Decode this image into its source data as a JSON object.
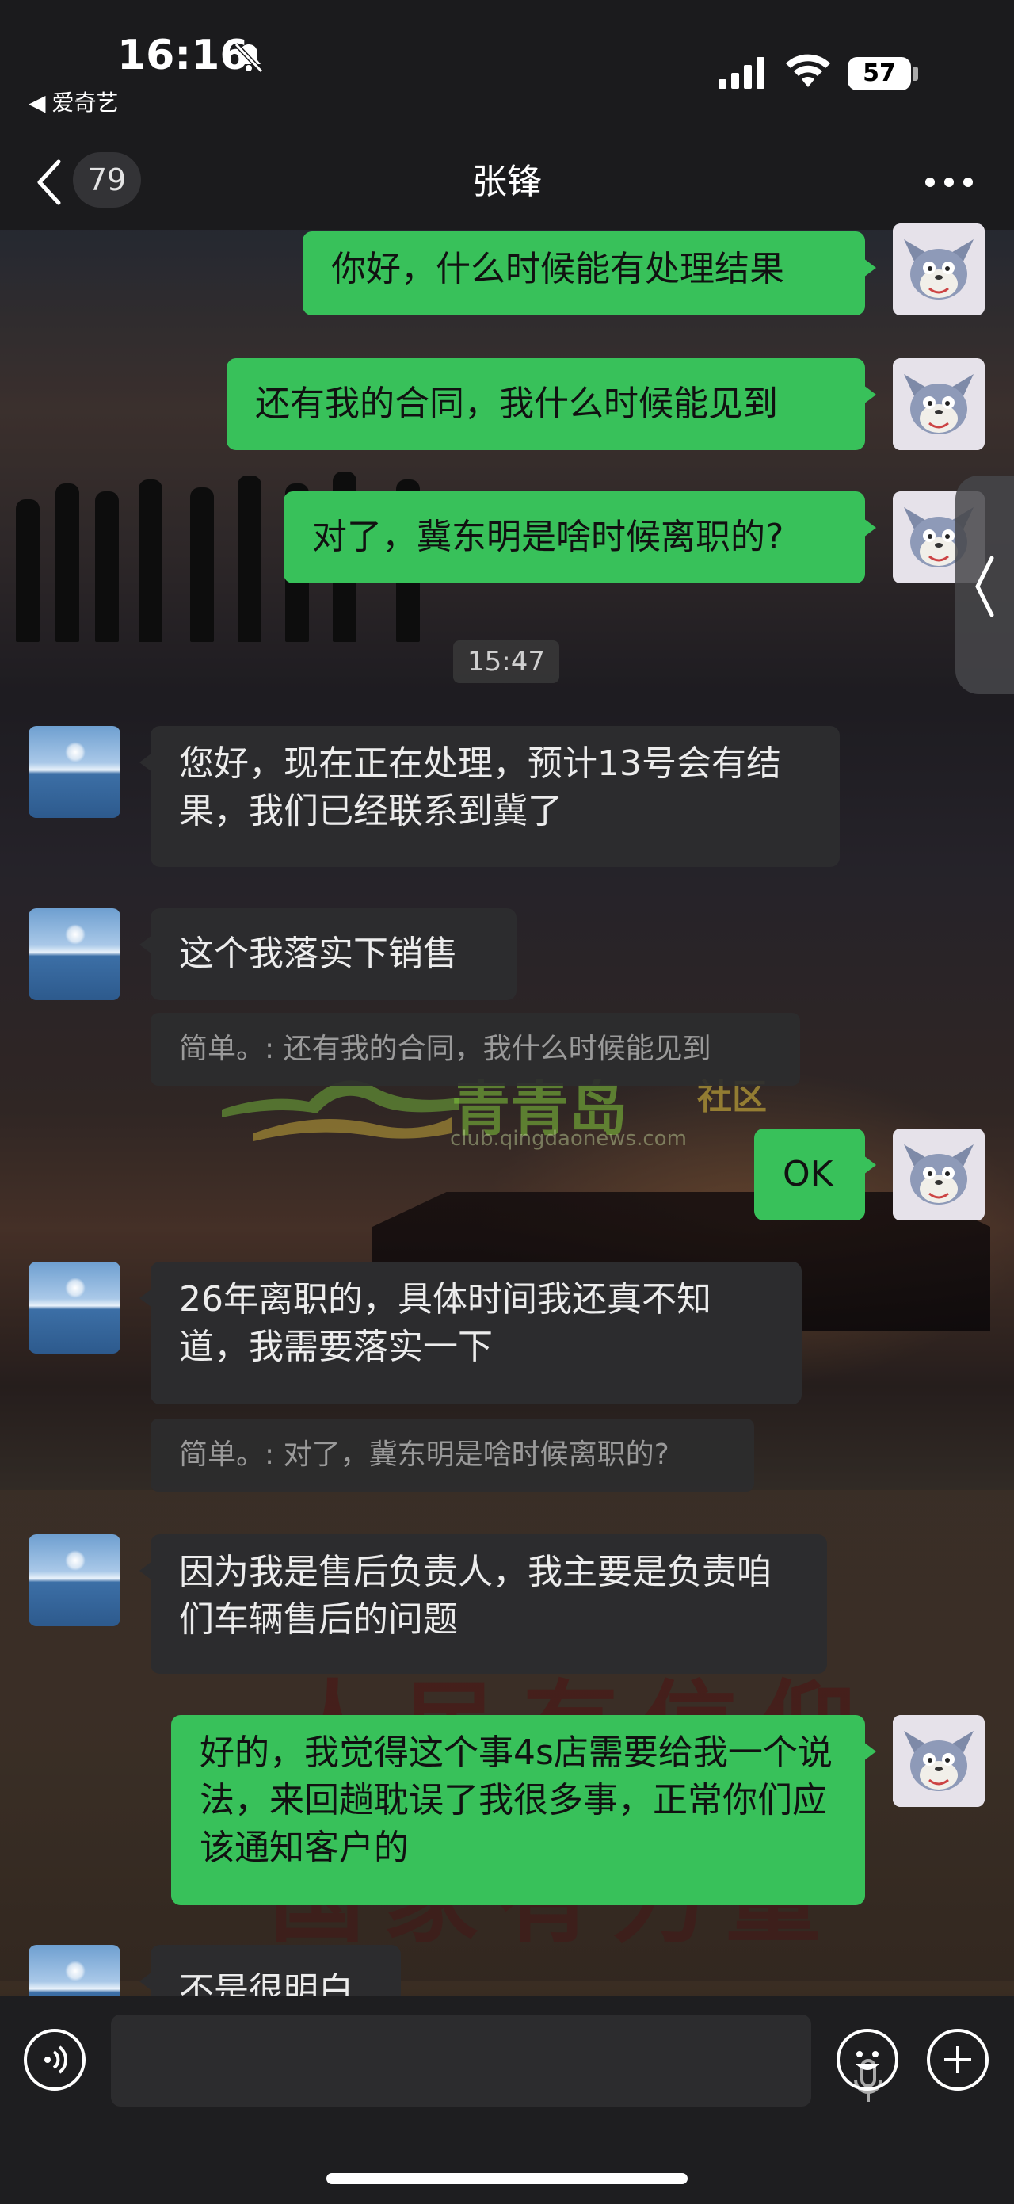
{
  "status_bar": {
    "time": "16:16",
    "back_app_label": "爱奇艺",
    "battery_percent": "57"
  },
  "nav": {
    "unread_count": "79",
    "title": "张锋"
  },
  "messages": [
    {
      "sender": "me",
      "text": "你好，什么时候能有处理结果"
    },
    {
      "sender": "me",
      "text": "还有我的合同，我什么时候能见到"
    },
    {
      "sender": "me",
      "text": "对了，冀东明是啥时候离职的?"
    },
    {
      "sender": "system",
      "text": "15:47"
    },
    {
      "sender": "other",
      "text": "您好，现在正在处理，预计13号会有结果，我们已经联系到冀了"
    },
    {
      "sender": "other",
      "text": "这个我落实下销售",
      "quote": "简单。: 还有我的合同，我什么时候能见到"
    },
    {
      "sender": "me",
      "text": "OK"
    },
    {
      "sender": "other",
      "text": "26年离职的，具体时间我还真不知道，我需要落实一下",
      "quote": "简单。: 对了，冀东明是啥时候离职的?"
    },
    {
      "sender": "other",
      "text": "因为我是售后负责人，我主要是负责咱们车辆售后的问题"
    },
    {
      "sender": "me",
      "text": "好的，我觉得这个事4s店需要给我一个说法，来回趟耽误了我很多事，正常你们应该通知客户的"
    },
    {
      "sender": "other",
      "text": "不是很明白"
    }
  ],
  "watermark": {
    "brand": "青青岛",
    "sub": "社区",
    "url": "club.qingdaonews.com"
  },
  "colors": {
    "my_bubble": "#38c15a",
    "other_bubble": "#2c2c2e",
    "bar_bg": "#1b1b1d"
  },
  "icons": {
    "input_left": "voice-icon",
    "input_mic": "microphone-icon",
    "input_emoji": "emoji-icon",
    "input_plus": "plus-icon"
  }
}
